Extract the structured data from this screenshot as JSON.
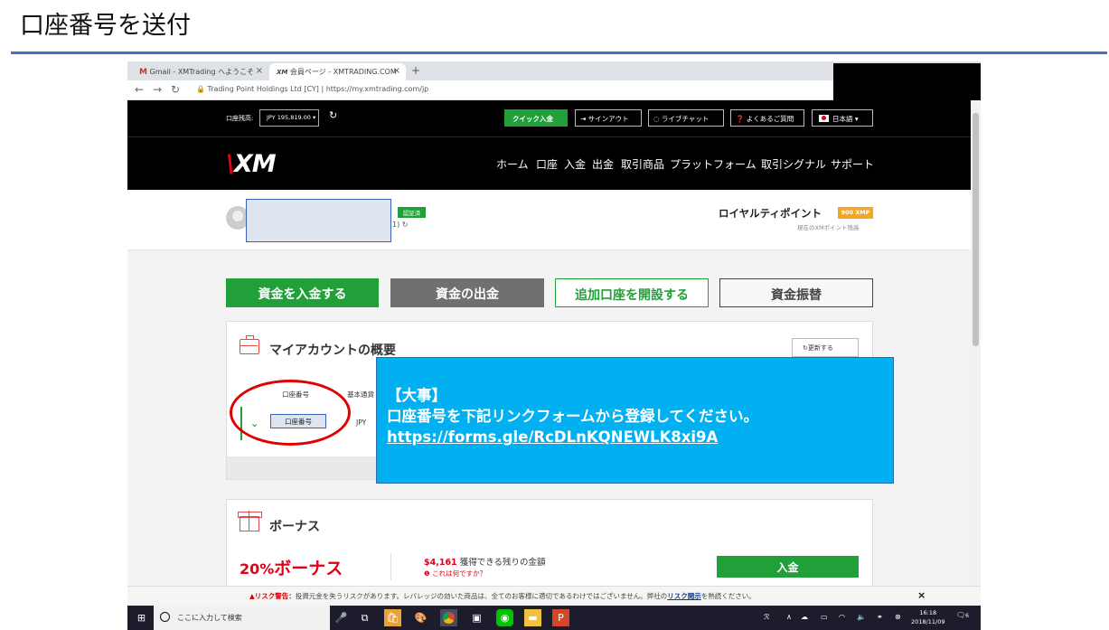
{
  "slide": {
    "title": "口座番号を送付"
  },
  "browser": {
    "tabs": [
      {
        "icon": "gmail-icon",
        "label": "Gmail - XMTrading へようこそ"
      },
      {
        "icon": "xm-icon",
        "label": "会員ページ - XMTRADING.COM"
      }
    ],
    "new_tab": "+",
    "url_site": "Trading Point Holdings Ltd [CY]",
    "url_sep": "|",
    "url": "https://my.xmtrading.com/jp"
  },
  "xm_header": {
    "balance_label": "口座残高:",
    "balance_value": "JPY 195,819.00 ▾",
    "quick_deposit": "クイック入金",
    "signout": "⇥ サインアウト",
    "livechat": "◌ ライブチャット",
    "faq": "❓ よくあるご質問",
    "language": "日本語 ▾",
    "logo": "XM",
    "nav": [
      "ホーム",
      "口座",
      "入金",
      "出金",
      "取引商品",
      "プラットフォーム",
      "取引シグナル",
      "サポート"
    ]
  },
  "profile": {
    "verified": "認証済",
    "account_tail": "1)",
    "loyalty_label": "ロイヤルティポイント",
    "loyalty_badge": "900 XMP",
    "loyalty_sub": "現在のXMポイント残高"
  },
  "actions": {
    "deposit": "資金を入金する",
    "withdraw": "資金の出金",
    "open_account": "追加口座を開設する",
    "transfer": "資金振替"
  },
  "my_account": {
    "title": "マイアカウントの概要",
    "refresh": "↻更新する",
    "col_account": "口座番号",
    "col_currency": "基本通貨",
    "row_account": "口座番号",
    "row_currency": "JPY"
  },
  "callout": {
    "line1": "【大事】",
    "line2": "口座番号を下記リンクフォームから登録してください。",
    "link": "https://forms.gle/RcDLnKQNEWLK8xi9A"
  },
  "bonus": {
    "title": "ボーナス",
    "pct_number": "20%",
    "pct_word": "ボーナス",
    "amount": "$4,161",
    "amount_label": "獲得できる残りの金額",
    "help": "❶ これは何ですか？",
    "deposit_btn": "入金"
  },
  "risk": {
    "warn": "▲リスク警告：",
    "text": "投資元金を失うリスクがあります。レバレッジの効いた商品は、全てのお客様に適切であるわけではございません。弊社の",
    "link": "リスク開示",
    "tail": "を熟読ください。",
    "close": "×"
  },
  "taskbar": {
    "search": "ここに入力して検索",
    "time": "16:18",
    "date": "2018/11/09",
    "notifications": "6"
  }
}
